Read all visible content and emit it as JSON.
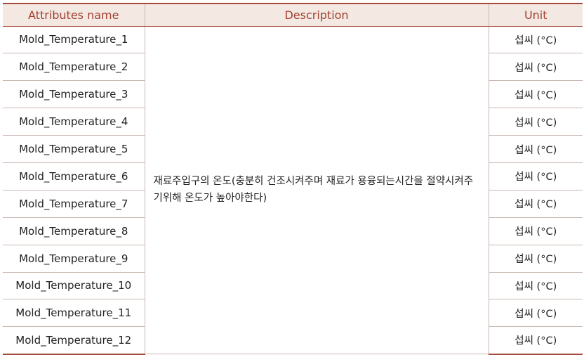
{
  "table": {
    "headers": {
      "attr": "Attributes name",
      "desc": "Description",
      "unit": "Unit"
    },
    "description": "재료주입구의 온도(충분히 건조시켜주며 재료가 용융되는시간을 절약시켜주기위해 온도가 높아야한다)",
    "rows": [
      {
        "attr": "Mold_Temperature_1",
        "unit": "섭씨 (°C)"
      },
      {
        "attr": "Mold_Temperature_2",
        "unit": "섭씨 (°C)"
      },
      {
        "attr": "Mold_Temperature_3",
        "unit": "섭씨 (°C)"
      },
      {
        "attr": "Mold_Temperature_4",
        "unit": "섭씨 (°C)"
      },
      {
        "attr": "Mold_Temperature_5",
        "unit": "섭씨 (°C)"
      },
      {
        "attr": "Mold_Temperature_6",
        "unit": "섭씨 (°C)"
      },
      {
        "attr": "Mold_Temperature_7",
        "unit": "섭씨 (°C)"
      },
      {
        "attr": "Mold_Temperature_8",
        "unit": "섭씨 (°C)"
      },
      {
        "attr": "Mold_Temperature_9",
        "unit": "섭씨 (°C)"
      },
      {
        "attr": "Mold_Temperature_10",
        "unit": "섭씨 (°C)"
      },
      {
        "attr": "Mold_Temperature_11",
        "unit": "섭씨 (°C)"
      },
      {
        "attr": "Mold_Temperature_12",
        "unit": "섭씨 (°C)"
      }
    ]
  }
}
